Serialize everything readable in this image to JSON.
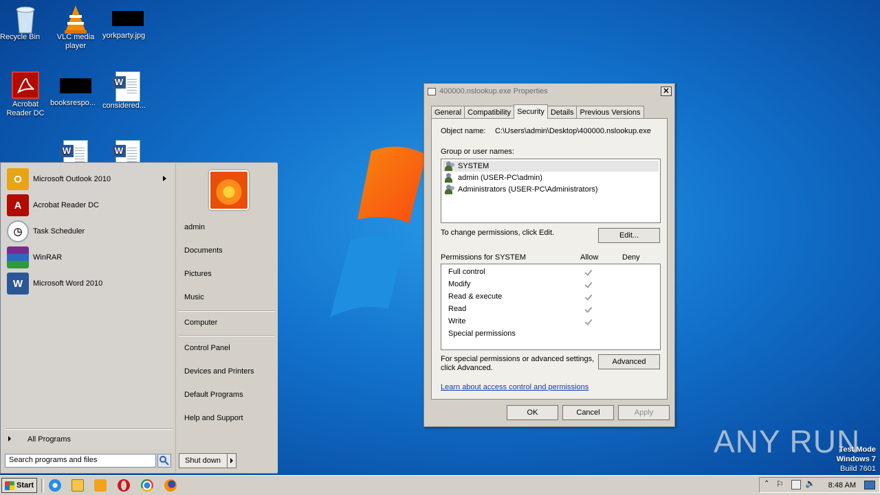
{
  "desktop": {
    "icons": [
      {
        "label": "Recycle Bin",
        "icon": "recycle-bin-icon"
      },
      {
        "label": "VLC media player",
        "icon": "vlc-cone-icon"
      },
      {
        "label": "yorkparty.jpg",
        "icon": "image-file-icon"
      },
      {
        "label": "Acrobat Reader DC",
        "icon": "acrobat-icon"
      },
      {
        "label": "booksrespo...",
        "icon": "file-icon"
      },
      {
        "label": "considered...",
        "icon": "word-doc-icon"
      }
    ],
    "watermark": "ANY RUN",
    "test_mode": {
      "line1": "Test Mode",
      "line2": "Windows 7",
      "line3": "Build 7601"
    }
  },
  "start_menu": {
    "pinned": [
      {
        "label": "Microsoft Outlook 2010",
        "icon": "outlook-icon",
        "has_submenu": true,
        "color": "#e8a417"
      },
      {
        "label": "Acrobat Reader DC",
        "icon": "acrobat-icon",
        "color": "#b30b00"
      },
      {
        "label": "Task Scheduler",
        "icon": "clock-icon",
        "color": "#9aa7b3"
      },
      {
        "label": "WinRAR",
        "icon": "winrar-icon",
        "color": "#7b2a8c"
      },
      {
        "label": "Microsoft Word 2010",
        "icon": "word-icon",
        "color": "#2b5797"
      }
    ],
    "all_programs": "All Programs",
    "search_value": "Search programs and files",
    "right_links": [
      "admin",
      "Documents",
      "Pictures",
      "Music",
      "Computer",
      "Control Panel",
      "Devices and Printers",
      "Default Programs",
      "Help and Support"
    ],
    "shutdown_label": "Shut down"
  },
  "dialog": {
    "title": "400000.nslookup.exe Properties",
    "tabs": [
      "General",
      "Compatibility",
      "Security",
      "Details",
      "Previous Versions"
    ],
    "active_tab": "Security",
    "object_name_label": "Object name:",
    "object_name_value": "C:\\Users\\admin\\Desktop\\400000.nslookup.exe",
    "group_label": "Group or user names:",
    "principals": [
      "SYSTEM",
      "admin (USER-PC\\admin)",
      "Administrators (USER-PC\\Administrators)"
    ],
    "selected_principal": "SYSTEM",
    "change_text": "To change permissions, click Edit.",
    "edit_button": "Edit...",
    "permissions_for": "Permissions for SYSTEM",
    "allow_header": "Allow",
    "deny_header": "Deny",
    "permissions": [
      {
        "name": "Full control",
        "allow": true
      },
      {
        "name": "Modify",
        "allow": true
      },
      {
        "name": "Read & execute",
        "allow": true
      },
      {
        "name": "Read",
        "allow": true
      },
      {
        "name": "Write",
        "allow": true
      },
      {
        "name": "Special permissions",
        "allow": false
      }
    ],
    "special_text_1": "For special permissions or advanced settings,",
    "special_text_2": "click Advanced.",
    "advanced_button": "Advanced",
    "learn_link": "Learn about access control and permissions",
    "ok_button": "OK",
    "cancel_button": "Cancel",
    "apply_button": "Apply"
  },
  "taskbar": {
    "start_label": "Start",
    "apps": [
      "internet-explorer-icon",
      "explorer-folder-icon",
      "media-player-icon",
      "opera-icon",
      "chrome-icon",
      "firefox-icon"
    ],
    "clock": "8:48 AM"
  }
}
